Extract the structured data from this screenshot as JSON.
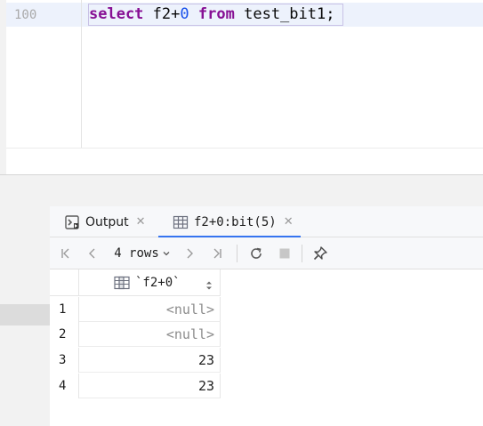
{
  "editor": {
    "line_number": "100",
    "code": {
      "kw_select": "select",
      "expr_field": "f2",
      "expr_plus": "+",
      "expr_num": "0",
      "kw_from": "from",
      "table": "test_bit1",
      "semicolon": ";"
    }
  },
  "results": {
    "tabs": [
      {
        "label": "Output",
        "icon": "console-icon",
        "active": false
      },
      {
        "label": "f2+0:bit(5)",
        "icon": "table-icon",
        "active": true
      }
    ],
    "toolbar": {
      "rows_label": "4 rows",
      "icons": [
        "first-page-icon",
        "prev-page-icon",
        "next-page-icon",
        "last-page-icon",
        "refresh-icon",
        "stop-icon",
        "pin-icon"
      ]
    },
    "grid": {
      "column_header": "`f2+0`",
      "rows": [
        {
          "num": "1",
          "value": "<null>"
        },
        {
          "num": "2",
          "value": "<null>"
        },
        {
          "num": "3",
          "value": "23"
        },
        {
          "num": "4",
          "value": "23"
        }
      ]
    }
  },
  "colors": {
    "keyword": "#871094",
    "number": "#1750eb",
    "current_line": "#edf2fc",
    "active_tab": "#3574f0"
  }
}
